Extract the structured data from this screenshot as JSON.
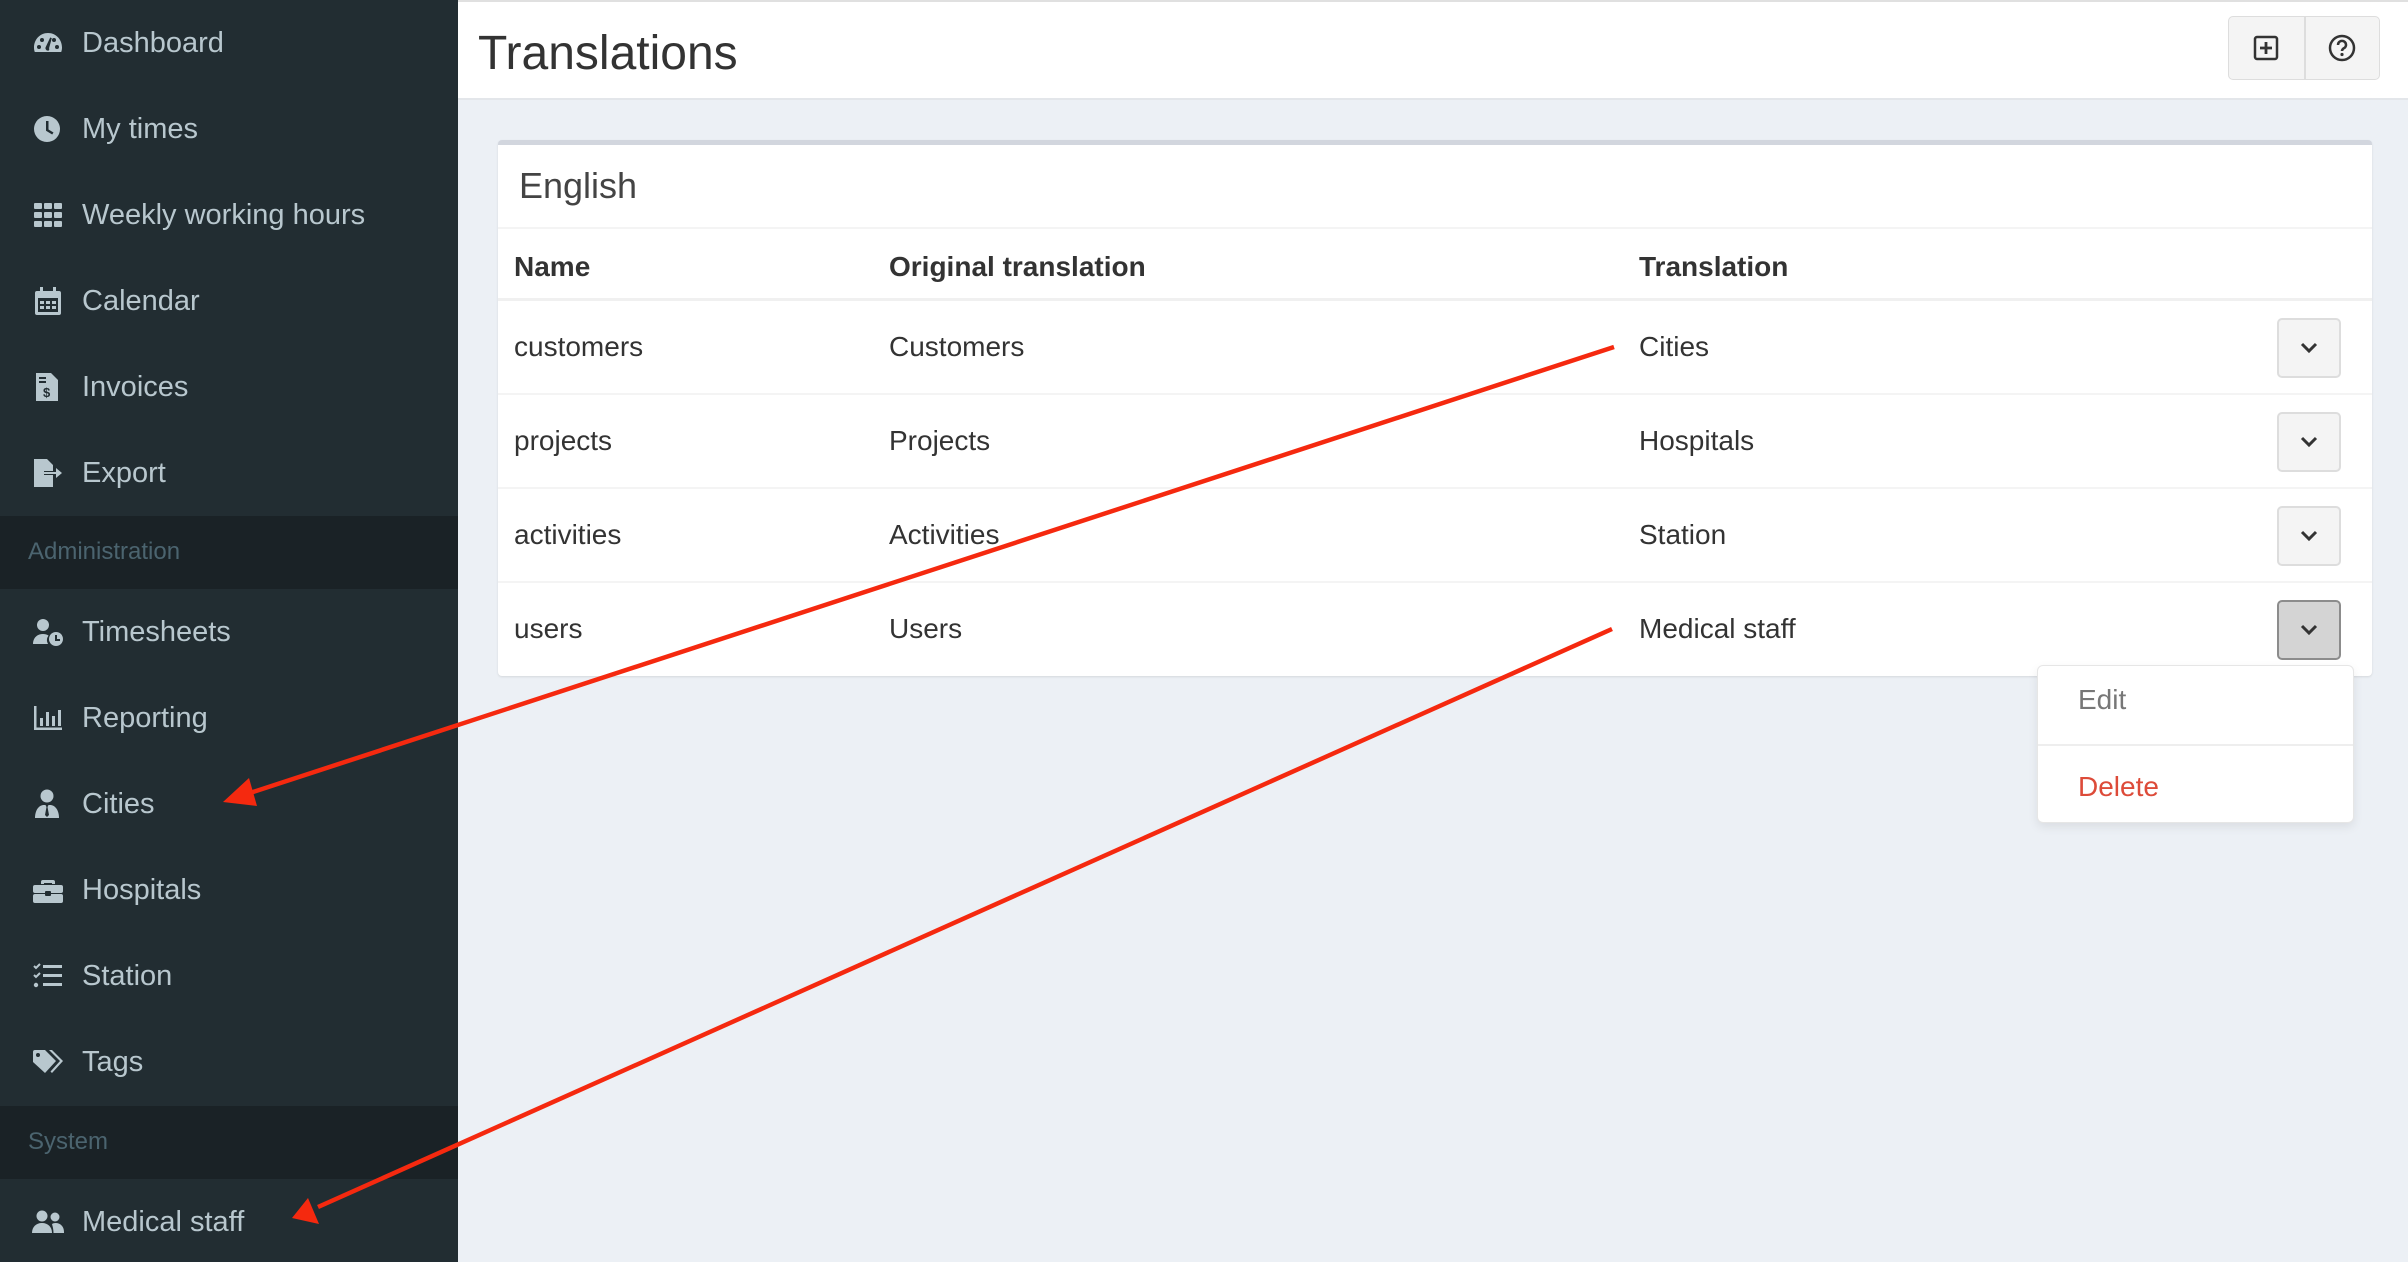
{
  "sidebar": {
    "items": [
      {
        "label": "Dashboard",
        "icon": "dashboard-icon"
      },
      {
        "label": "My times",
        "icon": "clock-icon"
      },
      {
        "label": "Weekly working hours",
        "icon": "grid-icon"
      },
      {
        "label": "Calendar",
        "icon": "calendar-icon"
      },
      {
        "label": "Invoices",
        "icon": "invoice-icon"
      },
      {
        "label": "Export",
        "icon": "export-icon"
      }
    ],
    "admin_header": "Administration",
    "admin_items": [
      {
        "label": "Timesheets",
        "icon": "user-clock-icon"
      },
      {
        "label": "Reporting",
        "icon": "chart-bar-icon"
      },
      {
        "label": "Cities",
        "icon": "user-tie-icon"
      },
      {
        "label": "Hospitals",
        "icon": "briefcase-icon"
      },
      {
        "label": "Station",
        "icon": "tasks-icon"
      },
      {
        "label": "Tags",
        "icon": "tags-icon"
      }
    ],
    "system_header": "System",
    "system_items": [
      {
        "label": "Medical staff",
        "icon": "users-icon"
      }
    ]
  },
  "header": {
    "title": "Translations",
    "buttons": [
      {
        "name": "create",
        "icon": "plus-square-icon"
      },
      {
        "name": "help",
        "icon": "question-circle-icon"
      }
    ]
  },
  "card": {
    "title": "English",
    "columns": [
      "Name",
      "Original translation",
      "Translation"
    ],
    "rows": [
      {
        "name": "customers",
        "original": "Customers",
        "translation": "Cities"
      },
      {
        "name": "projects",
        "original": "Projects",
        "translation": "Hospitals"
      },
      {
        "name": "activities",
        "original": "Activities",
        "translation": "Station"
      },
      {
        "name": "users",
        "original": "Users",
        "translation": "Medical staff"
      }
    ]
  },
  "dropdown_menu": {
    "open_for_row": "users",
    "items": [
      {
        "label": "Edit",
        "color": "#777777"
      },
      {
        "label": "Delete",
        "color": "#dd4b39"
      }
    ]
  },
  "annotations": {
    "arrow_color": "#f5290f",
    "arrows": [
      {
        "from": "translation-cities",
        "to": "sidebar-item-cities"
      },
      {
        "from": "translation-medical-staff",
        "to": "sidebar-item-medical-staff"
      }
    ]
  },
  "colors": {
    "sidebar_bg": "#222d32",
    "sidebar_header_bg": "#1a2226",
    "sidebar_text": "#b8c7ce",
    "content_bg": "#ecf0f5",
    "danger": "#dd4b39"
  }
}
